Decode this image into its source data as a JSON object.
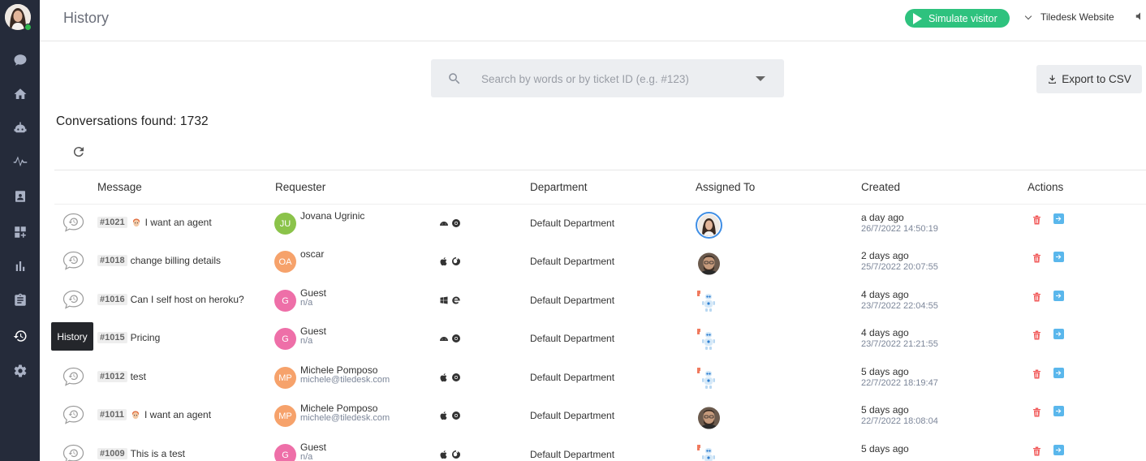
{
  "header": {
    "title": "History",
    "simulate_label": "Simulate visitor",
    "project_name": "Tiledesk Website"
  },
  "sidebar": {
    "tooltip": "History",
    "items": [
      {
        "icon": "chat-bubble-icon"
      },
      {
        "icon": "home-icon"
      },
      {
        "icon": "bot-icon"
      },
      {
        "icon": "activity-icon"
      },
      {
        "icon": "contacts-icon"
      },
      {
        "icon": "apps-icon"
      },
      {
        "icon": "analytics-icon"
      },
      {
        "icon": "clipboard-icon"
      },
      {
        "icon": "history-icon",
        "active": true
      },
      {
        "icon": "settings-icon"
      }
    ]
  },
  "search": {
    "placeholder": "Search by words or by ticket ID (e.g. #123)"
  },
  "export_label": "Export to CSV",
  "conversations_found": "Conversations found: 1732",
  "table": {
    "headers": {
      "message": "Message",
      "requester": "Requester",
      "department": "Department",
      "assigned": "Assigned To",
      "created": "Created",
      "actions": "Actions"
    },
    "rows": [
      {
        "ticket": "#1021",
        "emoji": true,
        "message": "I want an agent",
        "initials": "JU",
        "avatar_color": "#8bc34a",
        "name": "Jovana Ugrinic",
        "sub": "",
        "os": [
          "android",
          "chrome"
        ],
        "department": "Default Department",
        "assignee": "woman",
        "rel": "a day ago",
        "abs": "26/7/2022 14:50:19"
      },
      {
        "ticket": "#1018",
        "emoji": false,
        "message": "change billing details",
        "initials": "OA",
        "avatar_color": "#f6a26b",
        "name": "oscar",
        "sub": "",
        "os": [
          "apple",
          "firefox"
        ],
        "department": "Default Department",
        "assignee": "man",
        "rel": "2 days ago",
        "abs": "25/7/2022 20:07:55"
      },
      {
        "ticket": "#1016",
        "emoji": false,
        "message": "Can I self host on heroku?",
        "initials": "G",
        "avatar_color": "#ee6fa8",
        "name": "Guest",
        "sub": "n/a",
        "os": [
          "windows",
          "edge"
        ],
        "department": "Default Department",
        "assignee": "bot",
        "rel": "4 days ago",
        "abs": "23/7/2022 22:04:55"
      },
      {
        "ticket": "#1015",
        "emoji": false,
        "message": "Pricing",
        "initials": "G",
        "avatar_color": "#ee6fa8",
        "name": "Guest",
        "sub": "n/a",
        "os": [
          "android",
          "chrome"
        ],
        "department": "Default Department",
        "assignee": "bot",
        "rel": "4 days ago",
        "abs": "23/7/2022 21:21:55"
      },
      {
        "ticket": "#1012",
        "emoji": false,
        "message": "test",
        "initials": "MP",
        "avatar_color": "#f6a26b",
        "name": "Michele Pomposo",
        "sub": "michele@tiledesk.com",
        "os": [
          "apple",
          "chrome"
        ],
        "department": "Default Department",
        "assignee": "bot",
        "rel": "5 days ago",
        "abs": "22/7/2022 18:19:47"
      },
      {
        "ticket": "#1011",
        "emoji": true,
        "message": "I want an agent",
        "initials": "MP",
        "avatar_color": "#f6a26b",
        "name": "Michele Pomposo",
        "sub": "michele@tiledesk.com",
        "os": [
          "apple",
          "chrome"
        ],
        "department": "Default Department",
        "assignee": "man",
        "rel": "5 days ago",
        "abs": "22/7/2022 18:08:04"
      },
      {
        "ticket": "#1009",
        "emoji": false,
        "message": "This is a test",
        "initials": "G",
        "avatar_color": "#ee6fa8",
        "name": "Guest",
        "sub": "n/a",
        "os": [
          "apple",
          "firefox"
        ],
        "department": "Default Department",
        "assignee": "bot",
        "rel": "5 days ago",
        "abs": ""
      }
    ]
  }
}
